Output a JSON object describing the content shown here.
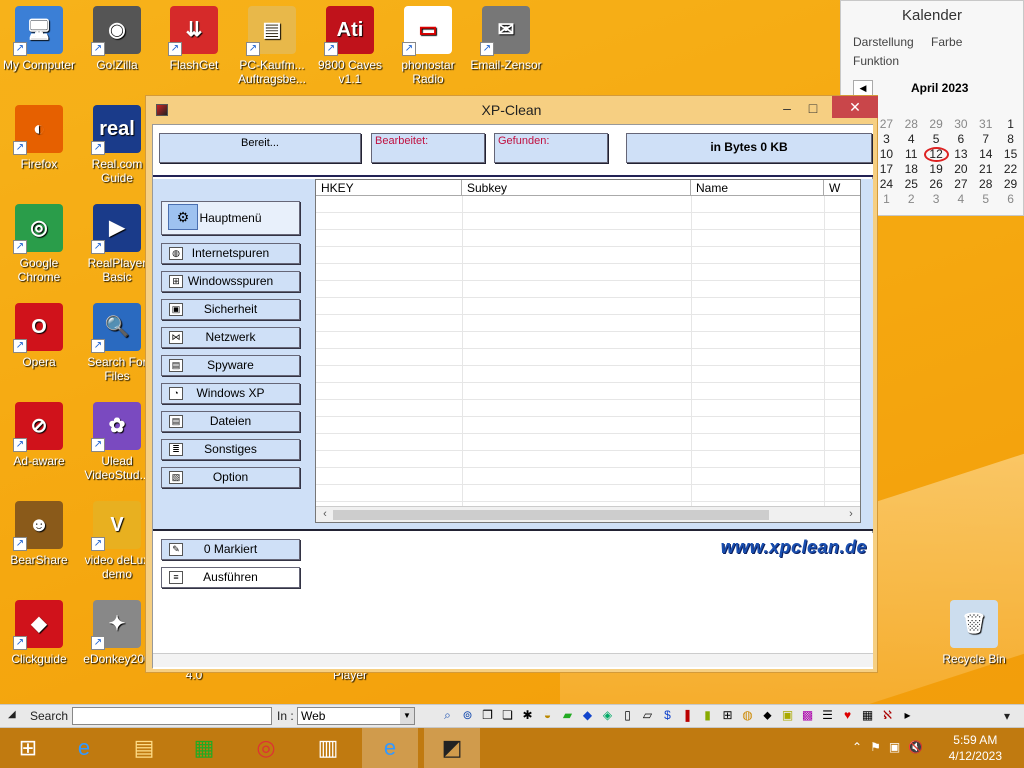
{
  "desktop": {
    "icons": [
      {
        "label": "My Computer",
        "icon": "computer-icon",
        "color": "#3b7fd6",
        "glyph": "🖥"
      },
      {
        "label": "Go!Zilla",
        "icon": "gozilla-icon",
        "color": "#555",
        "glyph": "◉"
      },
      {
        "label": "FlashGet",
        "icon": "flashget-icon",
        "color": "#d62a2a",
        "glyph": "⇊"
      },
      {
        "label": "PC-Kaufm... Auftragsbe...",
        "icon": "folder-icon",
        "color": "#e8b84a",
        "glyph": "▤"
      },
      {
        "label": "9800 Caves v1.1",
        "icon": "ati-icon",
        "color": "#c0121b",
        "glyph": "Ati"
      },
      {
        "label": "phonostar Radio",
        "icon": "radio-icon",
        "color": "#ffffff",
        "glyph": "▭"
      },
      {
        "label": "Email-Zensor",
        "icon": "email-zensor-icon",
        "color": "#777",
        "glyph": "✉"
      },
      {
        "label": "Firefox",
        "icon": "firefox-icon",
        "color": "#e66000",
        "glyph": "◐"
      },
      {
        "label": "Real.com Guide",
        "icon": "real-guide-icon",
        "color": "#1a3b8a",
        "glyph": "real"
      },
      {
        "label": "Google Chrome",
        "icon": "chrome-icon",
        "color": "#2a9d4a",
        "glyph": "◎"
      },
      {
        "label": "RealPlayer Basic",
        "icon": "realplayer-icon",
        "color": "#1a3b8a",
        "glyph": "▶"
      },
      {
        "label": "Opera",
        "icon": "opera-icon",
        "color": "#d0121b",
        "glyph": "O"
      },
      {
        "label": "Search For Files",
        "icon": "search-files-icon",
        "color": "#2a6ac0",
        "glyph": "🔍"
      },
      {
        "label": "Ad-aware",
        "icon": "adaware-icon",
        "color": "#d0121b",
        "glyph": "⊘"
      },
      {
        "label": "Ulead VideoStud...",
        "icon": "ulead-icon",
        "color": "#7a4ac0",
        "glyph": "✿"
      },
      {
        "label": "BearShare",
        "icon": "bearshare-icon",
        "color": "#8a5a1a",
        "glyph": "☻"
      },
      {
        "label": "video deLux demo",
        "icon": "video-delux-icon",
        "color": "#e8b020",
        "glyph": "V"
      },
      {
        "label": "Clickguide",
        "icon": "clickguide-icon",
        "color": "#d0121b",
        "glyph": "◆"
      },
      {
        "label": "eDonkey200",
        "icon": "edonkey-icon",
        "color": "#888",
        "glyph": "✦"
      },
      {
        "label": "Recycle Bin",
        "icon": "recycle-bin-icon",
        "color": "#cde",
        "glyph": "🗑"
      }
    ],
    "partial_labels": {
      "left": "4.0",
      "right": "Player"
    }
  },
  "kalender": {
    "title": "Kalender",
    "menu": [
      "Darstellung",
      "Farbe",
      "Funktion"
    ],
    "month": "April 2023",
    "weeks": [
      [
        {
          "d": "27",
          "dim": true
        },
        {
          "d": "28",
          "dim": true
        },
        {
          "d": "29",
          "dim": true
        },
        {
          "d": "30",
          "dim": true
        },
        {
          "d": "31",
          "dim": true
        },
        {
          "d": "1"
        }
      ],
      [
        {
          "d": "3"
        },
        {
          "d": "4"
        },
        {
          "d": "5"
        },
        {
          "d": "6"
        },
        {
          "d": "7"
        },
        {
          "d": "8"
        }
      ],
      [
        {
          "d": "10"
        },
        {
          "d": "11"
        },
        {
          "d": "12",
          "today": true
        },
        {
          "d": "13"
        },
        {
          "d": "14"
        },
        {
          "d": "15"
        }
      ],
      [
        {
          "d": "17"
        },
        {
          "d": "18"
        },
        {
          "d": "19"
        },
        {
          "d": "20"
        },
        {
          "d": "21"
        },
        {
          "d": "22"
        }
      ],
      [
        {
          "d": "24"
        },
        {
          "d": "25"
        },
        {
          "d": "26"
        },
        {
          "d": "27"
        },
        {
          "d": "28"
        },
        {
          "d": "29"
        }
      ],
      [
        {
          "d": "1",
          "dim": true
        },
        {
          "d": "2",
          "dim": true
        },
        {
          "d": "3",
          "dim": true
        },
        {
          "d": "4",
          "dim": true
        },
        {
          "d": "5",
          "dim": true
        },
        {
          "d": "6",
          "dim": true
        }
      ]
    ]
  },
  "xpclean": {
    "title": "XP-Clean",
    "status": {
      "ready": "Bereit...",
      "edited": "Bearbeitet:",
      "found": "Gefunden:",
      "bytes": "in Bytes 0 KB"
    },
    "main_menu": "Hauptmenü",
    "nav": [
      "Internetspuren",
      "Windowsspuren",
      "Sicherheit",
      "Netzwerk",
      "Spyware",
      "Windows XP",
      "Dateien",
      "Sonstiges",
      "Option"
    ],
    "columns": [
      "HKEY",
      "Subkey",
      "Name",
      "W"
    ],
    "marked": "0 Markiert",
    "run": "Ausführen",
    "brand": "www.xpclean.de"
  },
  "searchbar": {
    "search_label": "Search :",
    "in_label": "In :",
    "scope": "Web",
    "search_value": ""
  },
  "taskbar": {
    "time": "5:59 AM",
    "date": "4/12/2023"
  },
  "colors": {
    "accent": "#cfe0f7",
    "close": "#c9464a",
    "taskbar": "#c07a10",
    "wallpaper": "#f5a70f"
  }
}
